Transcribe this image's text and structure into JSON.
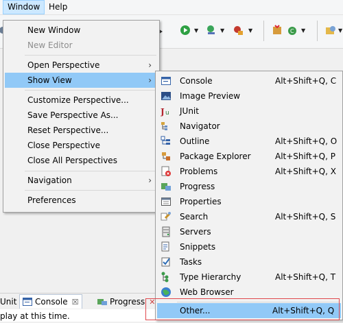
{
  "menubar": {
    "window": "Window",
    "help": "Help"
  },
  "window_menu": {
    "new_window": "New Window",
    "new_editor": "New Editor",
    "open_perspective": "Open Perspective",
    "show_view": "Show View",
    "customize_perspective": "Customize Perspective...",
    "save_perspective_as": "Save Perspective As...",
    "reset_perspective": "Reset Perspective...",
    "close_perspective": "Close Perspective",
    "close_all_perspectives": "Close All Perspectives",
    "navigation": "Navigation",
    "preferences": "Preferences"
  },
  "show_view_menu": {
    "items": [
      {
        "label": "Console",
        "accel": "Alt+Shift+Q, C",
        "icon": "console-icon"
      },
      {
        "label": "Image Preview",
        "accel": "",
        "icon": "image-preview-icon"
      },
      {
        "label": "JUnit",
        "accel": "",
        "icon": "junit-icon"
      },
      {
        "label": "Navigator",
        "accel": "",
        "icon": "navigator-icon"
      },
      {
        "label": "Outline",
        "accel": "Alt+Shift+Q, O",
        "icon": "outline-icon"
      },
      {
        "label": "Package Explorer",
        "accel": "Alt+Shift+Q, P",
        "icon": "package-explorer-icon"
      },
      {
        "label": "Problems",
        "accel": "Alt+Shift+Q, X",
        "icon": "problems-icon"
      },
      {
        "label": "Progress",
        "accel": "",
        "icon": "progress-icon"
      },
      {
        "label": "Properties",
        "accel": "",
        "icon": "properties-icon"
      },
      {
        "label": "Search",
        "accel": "Alt+Shift+Q, S",
        "icon": "search-icon"
      },
      {
        "label": "Servers",
        "accel": "",
        "icon": "servers-icon"
      },
      {
        "label": "Snippets",
        "accel": "",
        "icon": "snippets-icon"
      },
      {
        "label": "Tasks",
        "accel": "",
        "icon": "tasks-icon"
      },
      {
        "label": "Type Hierarchy",
        "accel": "Alt+Shift+Q, T",
        "icon": "type-hierarchy-icon"
      },
      {
        "label": "Web Browser",
        "accel": "",
        "icon": "web-browser-icon"
      }
    ],
    "other": {
      "label": "Other...",
      "accel": "Alt+Shift+Q, Q"
    }
  },
  "panel": {
    "tab_unit": "Unit",
    "tab_console": "Console",
    "tab_console_close": "☒",
    "tab_progress": "Progress",
    "tab_progress_close": "✕",
    "body_text": "play at this time."
  },
  "colors": {
    "highlight": "#91c9f7",
    "annotation_box": "#e0474c",
    "menubar_active": "#cce8ff"
  }
}
